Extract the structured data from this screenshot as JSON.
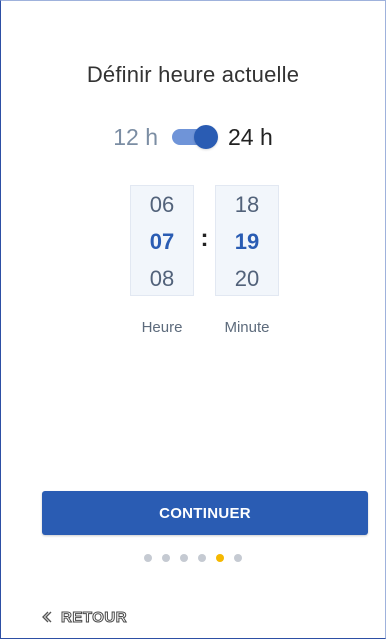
{
  "screen": {
    "title": "Définir heure actuelle"
  },
  "time_format": {
    "option_12h": "12 h",
    "option_24h": "24 h",
    "selected": "24 h",
    "toggle_state": "on"
  },
  "hours": {
    "label": "Heure",
    "above": "06",
    "selected": "07",
    "below": "08"
  },
  "minutes": {
    "label": "Minute",
    "above": "18",
    "selected": "19",
    "below": "20"
  },
  "separator": ":",
  "continue_button": {
    "label": "CONTINUER"
  },
  "progress": {
    "total_steps": 6,
    "current_step": 5
  },
  "back_link": {
    "label": "RETOUR",
    "icon": "chevron-left-icon"
  },
  "colors": {
    "accent": "#2a5cb3",
    "active_dot": "#f5b800",
    "inactive_dot": "#c5cad2"
  }
}
